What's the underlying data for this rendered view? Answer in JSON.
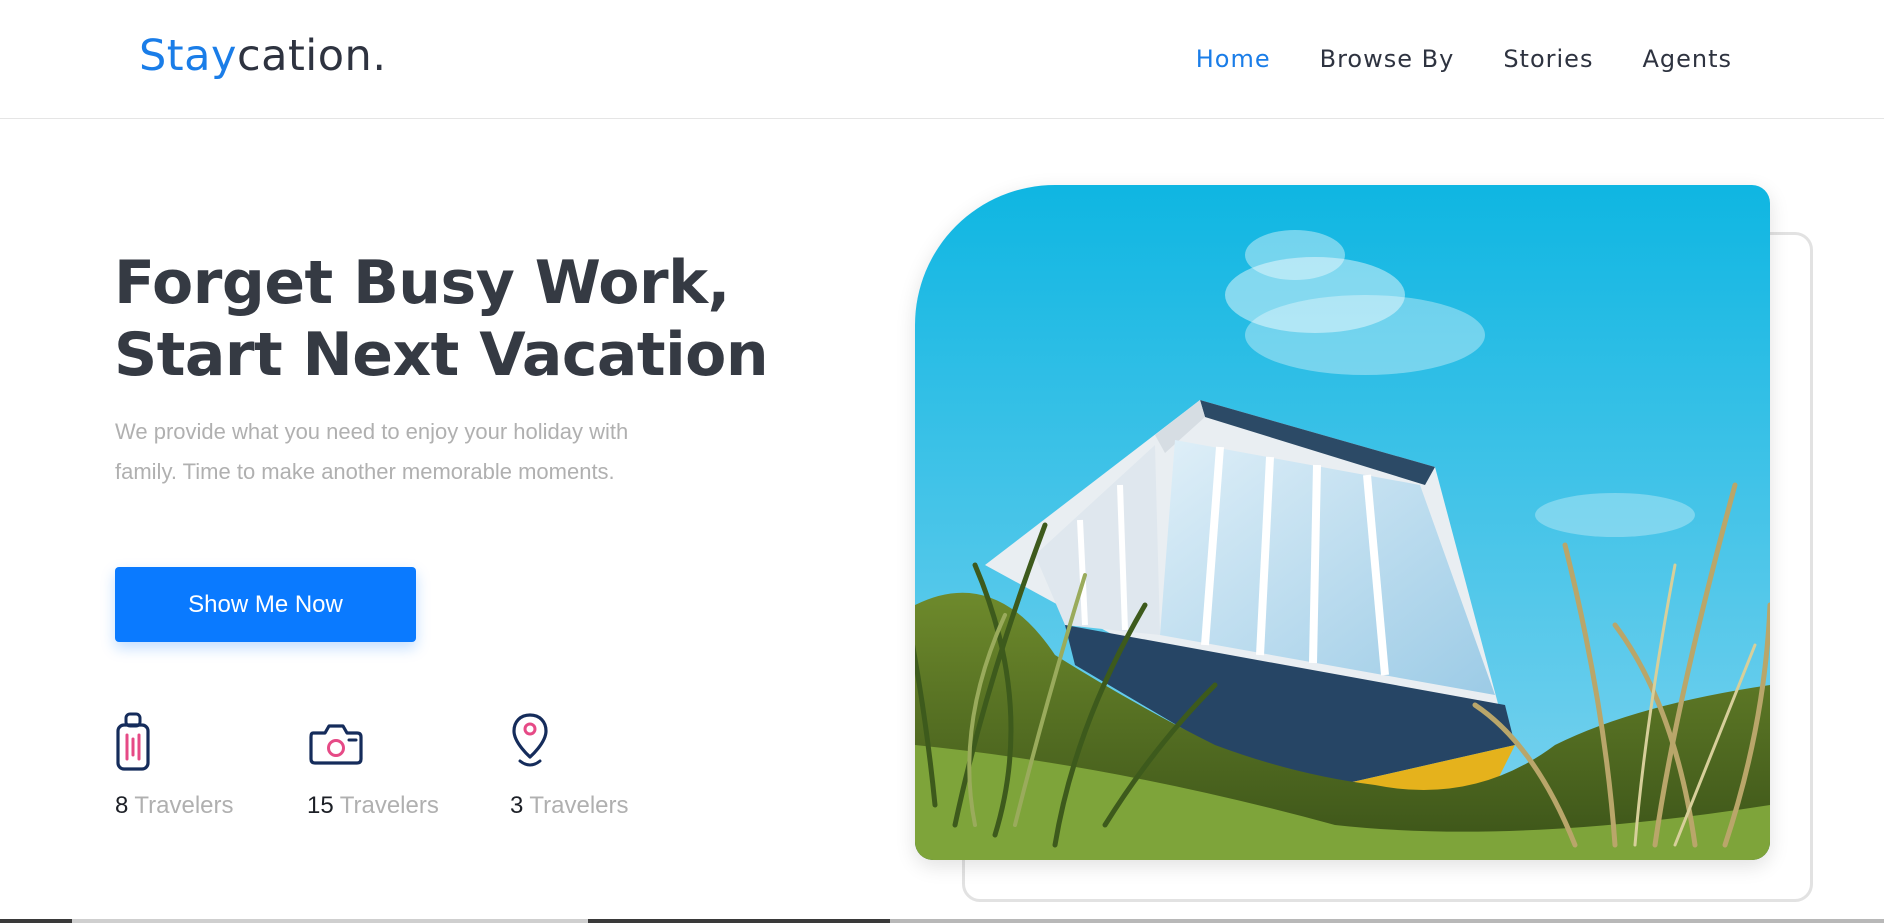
{
  "brand": {
    "part1": "Stay",
    "part2": "cation."
  },
  "nav": {
    "items": [
      {
        "label": "Home",
        "active": true
      },
      {
        "label": "Browse By",
        "active": false
      },
      {
        "label": "Stories",
        "active": false
      },
      {
        "label": "Agents",
        "active": false
      }
    ]
  },
  "hero": {
    "title_line1": "Forget Busy Work,",
    "title_line2": "Start Next Vacation",
    "description": "We provide what you need to enjoy your holiday with family. Time to make another memorable moments.",
    "cta_label": "Show Me Now"
  },
  "stats": [
    {
      "value": "8",
      "unit": "Travelers",
      "icon": "suitcase-icon"
    },
    {
      "value": "15",
      "unit": "Travelers",
      "icon": "camera-icon"
    },
    {
      "value": "3",
      "unit": "Travelers",
      "icon": "map-pin-icon"
    }
  ],
  "colors": {
    "accent": "#1a7de8",
    "button": "#0a7aff",
    "heading": "#353a43",
    "muted": "#b0b0b0",
    "icon_outline": "#152c5b",
    "icon_accent": "#e64a86"
  }
}
